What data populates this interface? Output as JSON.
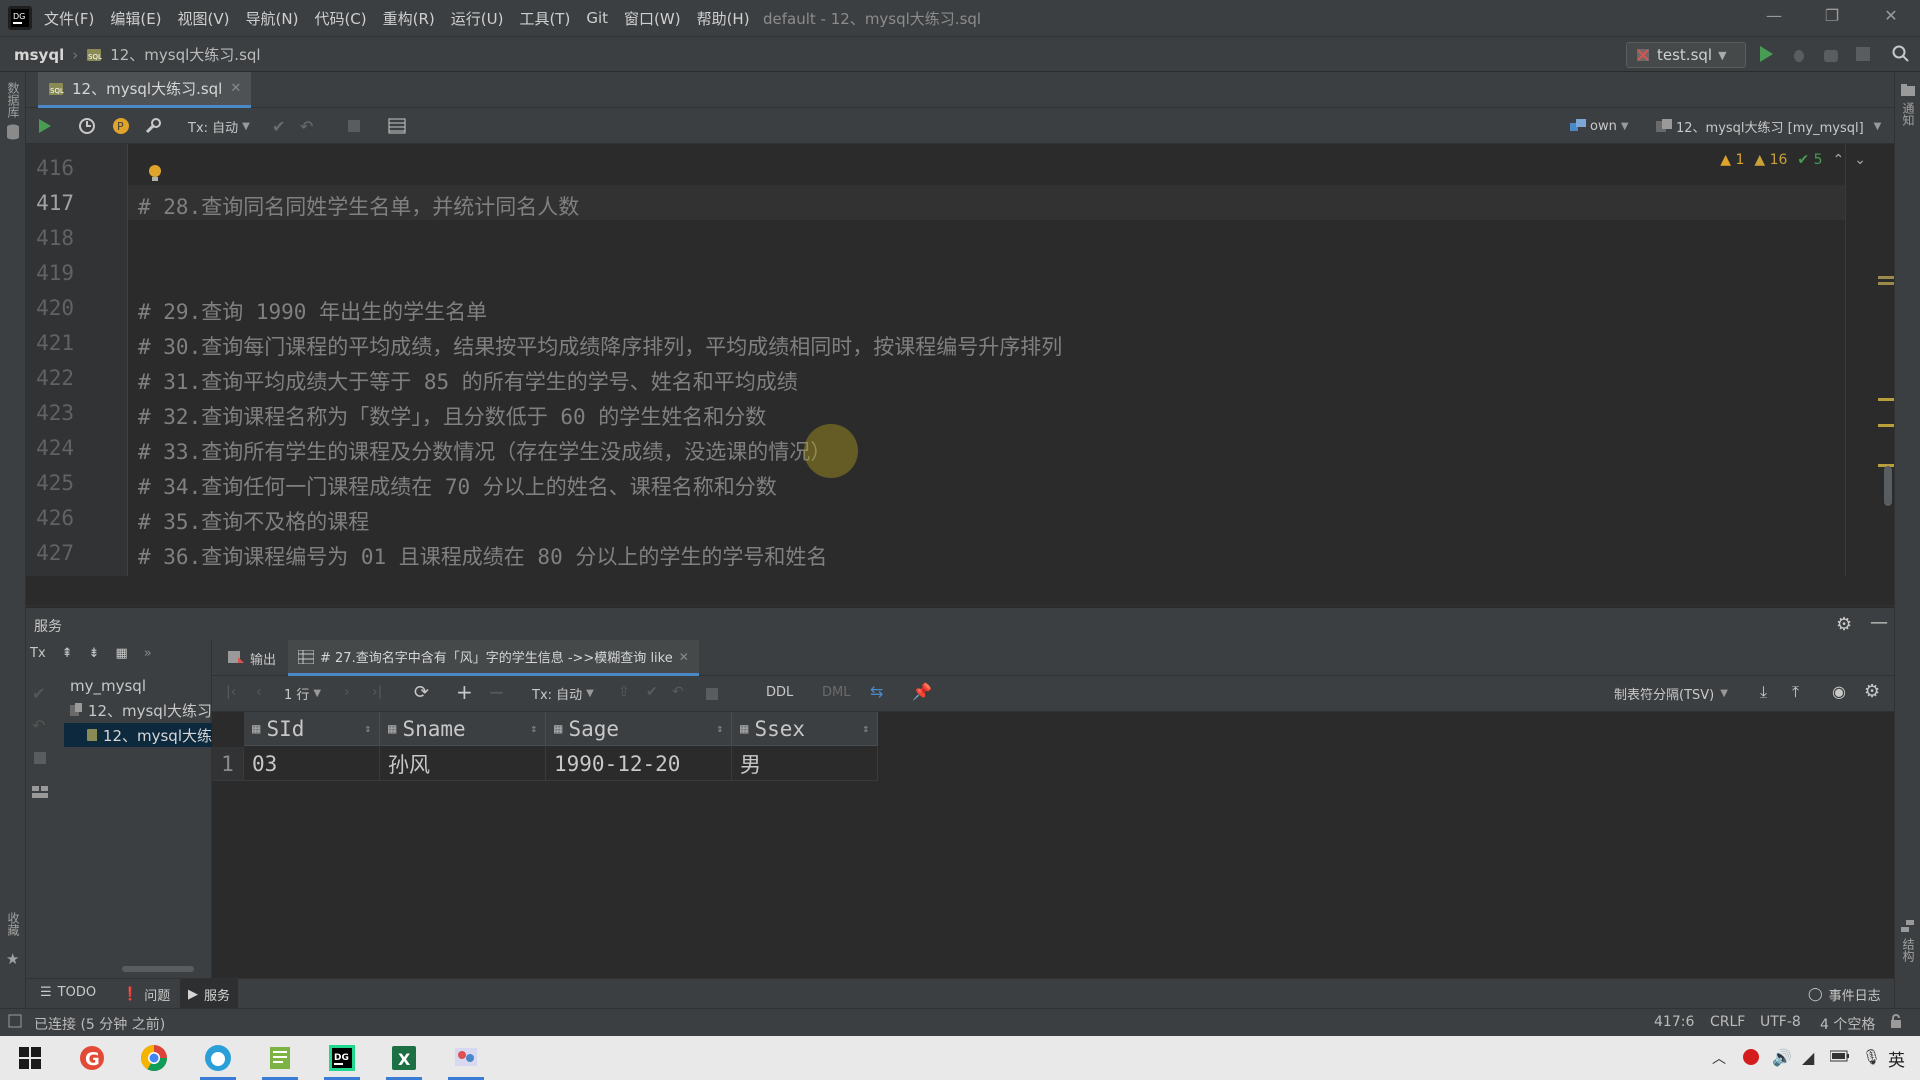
{
  "menu": [
    "文件(F)",
    "编辑(E)",
    "视图(V)",
    "导航(N)",
    "代码(C)",
    "重构(R)",
    "运行(U)",
    "工具(T)",
    "Git",
    "窗口(W)",
    "帮助(H)"
  ],
  "window_title": "default - 12、mysql大练习.sql",
  "breadcrumb": {
    "project": "msyql",
    "file": "12、mysql大练习.sql"
  },
  "run_config": "test.sql",
  "left_strip_label": "数据库",
  "left_strip_bottom_label": "收藏",
  "right_strip_label": "通知",
  "right_strip_bottom_label": "结构",
  "file_tab": "12、mysql大练习.sql",
  "editor_toolbar": {
    "tx_mode": "Tx: 自动",
    "schema_owner": "own",
    "datasource": "12、mysql大练习 [my_mysql]"
  },
  "inspections": {
    "errors": "1",
    "warnings": "16",
    "ok": "5"
  },
  "editor": {
    "current_line": "417",
    "lines": [
      {
        "num": "416",
        "text": ""
      },
      {
        "num": "417",
        "text": "# 28.查询同名同姓学生名单，并统计同名人数"
      },
      {
        "num": "418",
        "text": ""
      },
      {
        "num": "419",
        "text": ""
      },
      {
        "num": "420",
        "text": "# 29.查询 1990 年出生的学生名单"
      },
      {
        "num": "421",
        "text": "# 30.查询每门课程的平均成绩，结果按平均成绩降序排列，平均成绩相同时，按课程编号升序排列"
      },
      {
        "num": "422",
        "text": "# 31.查询平均成绩大于等于 85 的所有学生的学号、姓名和平均成绩"
      },
      {
        "num": "423",
        "text": "# 32.查询课程名称为「数学」，且分数低于 60 的学生姓名和分数"
      },
      {
        "num": "424",
        "text": "# 33.查询所有学生的课程及分数情况（存在学生没成绩，没选课的情况）"
      },
      {
        "num": "425",
        "text": "# 34.查询任何一门课程成绩在 70 分以上的姓名、课程名称和分数"
      },
      {
        "num": "426",
        "text": "# 35.查询不及格的课程"
      },
      {
        "num": "427",
        "text": "# 36.查询课程编号为 01 且课程成绩在 80 分以上的学生的学号和姓名"
      }
    ]
  },
  "services": {
    "title": "服务",
    "tree": {
      "root": "my_mysql",
      "child": "12、mysql大练习",
      "leaf": "12、mysql大练"
    },
    "tabs": {
      "output": "输出",
      "result": "# 27.查询名字中含有「风」字的学生信息 ->>模糊查询 like"
    },
    "toolbar": {
      "rows": "1 行",
      "tx_mode": "Tx: 自动",
      "ddl": "DDL",
      "dml": "DML",
      "export_format": "制表符分隔(TSV)"
    },
    "grid": {
      "columns": [
        "SId",
        "Sname",
        "Sage",
        "Ssex"
      ],
      "rows": [
        {
          "index": "1",
          "cells": [
            "03",
            "孙风",
            "1990-12-20",
            "男"
          ]
        }
      ]
    }
  },
  "bottom_tools": {
    "todo": "TODO",
    "problems": "问题",
    "services": "服务",
    "event_log": "事件日志"
  },
  "status": {
    "connection": "已连接 (5 分钟 之前)",
    "position": "417:6",
    "line_sep": "CRLF",
    "encoding": "UTF-8",
    "indent": "4 个空格"
  },
  "taskbar": {
    "ime": "英"
  },
  "colors": {
    "accent": "#4a88c7",
    "run_green": "#499c54",
    "warning": "#e0a42b",
    "error": "#d9534f"
  }
}
